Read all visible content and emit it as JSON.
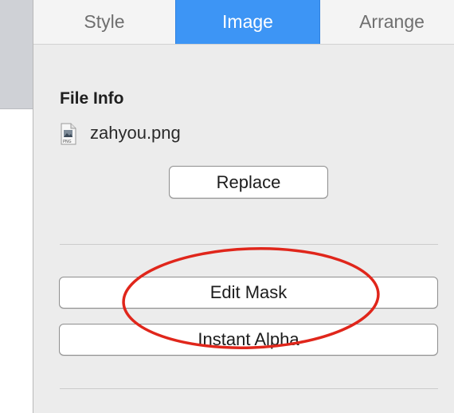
{
  "tabs": [
    {
      "label": "Style"
    },
    {
      "label": "Image"
    },
    {
      "label": "Arrange"
    }
  ],
  "file_info": {
    "title": "File Info",
    "file_name": "zahyou.png",
    "icon": "png-file-icon",
    "replace_label": "Replace"
  },
  "actions": {
    "edit_mask_label": "Edit Mask",
    "instant_alpha_label": "Instant Alpha"
  },
  "colors": {
    "accent_tab": "#3d95f5",
    "annotation": "#e0261b"
  }
}
